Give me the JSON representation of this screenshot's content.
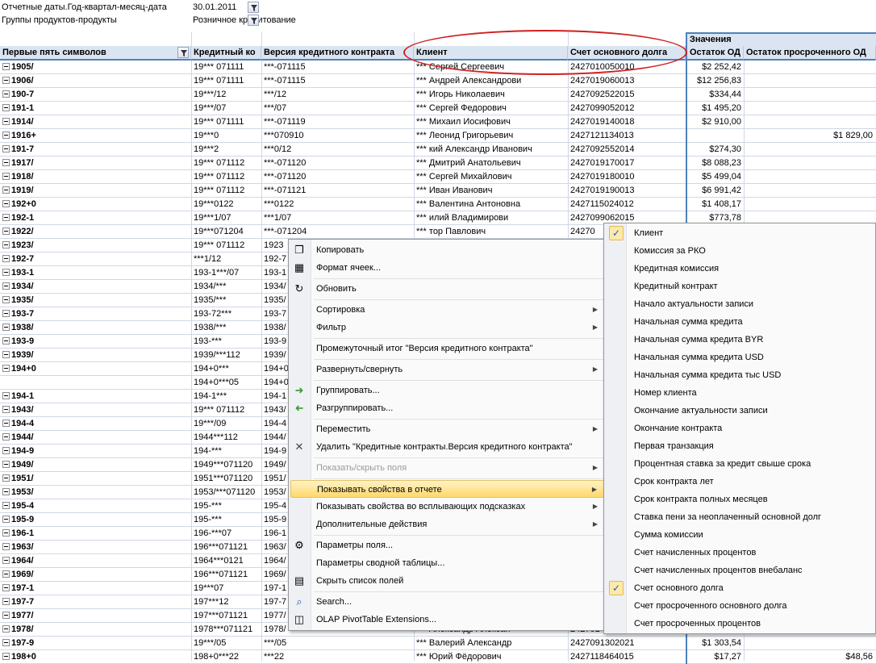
{
  "filters": {
    "row1": {
      "label": "Отчетные даты.Год-квартал-месяц-дата",
      "value": "30.01.2011"
    },
    "row2": {
      "label": "Группы продуктов-продукты",
      "value": "Розничное кредитование"
    }
  },
  "values_header": "Значения",
  "columns": [
    "Первые пять символов",
    "Кредитный ко",
    "Версия кредитного контракта",
    "Клиент",
    "Счет основного долга",
    "Остаток ОД",
    "Остаток просроченного ОД"
  ],
  "rows": [
    {
      "c0": "1905/",
      "c1": "19*** 071111",
      "c2": "***-071115",
      "c3": "*** Сергей Сергеевич",
      "c4": "2427010050010",
      "c5": "$2 252,42",
      "c6": ""
    },
    {
      "c0": "1906/",
      "c1": "19*** 071111",
      "c2": "***-071115",
      "c3": "*** Андрей Александрови",
      "c4": "2427019060013",
      "c5": "$12 256,83",
      "c6": ""
    },
    {
      "c0": "190-7",
      "c1": "19***/12",
      "c2": "***/12",
      "c3": "*** Игорь Николаевич",
      "c4": "2427092522015",
      "c5": "$334,44",
      "c6": ""
    },
    {
      "c0": "191-1",
      "c1": "19***/07",
      "c2": "***/07",
      "c3": "*** Сергей Федорович",
      "c4": "2427099052012",
      "c5": "$1 495,20",
      "c6": ""
    },
    {
      "c0": "1914/",
      "c1": "19*** 071111",
      "c2": "***-071119",
      "c3": "*** Михаил Иосифович",
      "c4": "2427019140018",
      "c5": "$2 910,00",
      "c6": ""
    },
    {
      "c0": "1916+",
      "c1": "19***0",
      "c2": "***070910",
      "c3": "*** Леонид Григорьевич",
      "c4": "2427121134013",
      "c5": "",
      "c6": "$1 829,00"
    },
    {
      "c0": "191-7",
      "c1": "19***2",
      "c2": "***0/12",
      "c3": "*** кий Александр Иванович",
      "c4": "2427092552014",
      "c5": "$274,30",
      "c6": ""
    },
    {
      "c0": "1917/",
      "c1": "19*** 071112",
      "c2": "***-071120",
      "c3": "*** Дмитрий Анатольевич",
      "c4": "2427019170017",
      "c5": "$8 088,23",
      "c6": ""
    },
    {
      "c0": "1918/",
      "c1": "19*** 071112",
      "c2": "***-071120",
      "c3": "*** Сергей Михайлович",
      "c4": "2427019180010",
      "c5": "$5 499,04",
      "c6": ""
    },
    {
      "c0": "1919/",
      "c1": "19*** 071112",
      "c2": "***-071121",
      "c3": "*** Иван Иванович",
      "c4": "2427019190013",
      "c5": "$6 991,42",
      "c6": ""
    },
    {
      "c0": "192+0",
      "c1": "19***0122",
      "c2": "***0122",
      "c3": "*** Валентина Антоновна",
      "c4": "2427115024012",
      "c5": "$1 408,17",
      "c6": ""
    },
    {
      "c0": "192-1",
      "c1": "19***1/07",
      "c2": "***1/07",
      "c3": "*** илий Владимирови",
      "c4": "2427099062015",
      "c5": "$773,78",
      "c6": ""
    },
    {
      "c0": "1922/",
      "c1": "19***071204",
      "c2": "***-071204",
      "c3": "*** тор Павлович",
      "c4": "24270",
      "c5": "",
      "c6": ""
    },
    {
      "c0": "1923/",
      "c1": "19*** 071112",
      "c2": "1923",
      "c3": "",
      "c4": "",
      "c5": "",
      "c6": ""
    },
    {
      "c0": "192-7",
      "c1": "***1/12",
      "c2": "192-7",
      "c3": "",
      "c4": "",
      "c5": "",
      "c6": ""
    },
    {
      "c0": "193-1",
      "c1": "193-1***/07",
      "c2": "193-1",
      "c3": "",
      "c4": "",
      "c5": "",
      "c6": ""
    },
    {
      "c0": "1934/",
      "c1": "1934/***",
      "c2": "1934/",
      "c3": "",
      "c4": "",
      "c5": "",
      "c6": ""
    },
    {
      "c0": "1935/",
      "c1": "1935/***",
      "c2": "1935/",
      "c3": "",
      "c4": "",
      "c5": "",
      "c6": ""
    },
    {
      "c0": "193-7",
      "c1": "193-72***",
      "c2": "193-7",
      "c3": "",
      "c4": "",
      "c5": "",
      "c6": ""
    },
    {
      "c0": "1938/",
      "c1": "1938/***",
      "c2": "1938/",
      "c3": "",
      "c4": "",
      "c5": "",
      "c6": ""
    },
    {
      "c0": "193-9",
      "c1": "193-***",
      "c2": "193-9",
      "c3": "",
      "c4": "",
      "c5": "",
      "c6": ""
    },
    {
      "c0": "1939/",
      "c1": "1939/***112",
      "c2": "1939/",
      "c3": "",
      "c4": "",
      "c5": "",
      "c6": ""
    },
    {
      "c0": "194+0",
      "c1": "194+0***",
      "c2": "194+0",
      "c3": "",
      "c4": "",
      "c5": "",
      "c6": ""
    },
    {
      "c0": "",
      "c1": "194+0***05",
      "c2": "194+0",
      "c3": "",
      "c4": "",
      "c5": "",
      "c6": ""
    },
    {
      "c0": "194-1",
      "c1": "194-1***",
      "c2": "194-1",
      "c3": "",
      "c4": "",
      "c5": "",
      "c6": ""
    },
    {
      "c0": "1943/",
      "c1": "19*** 071112",
      "c2": "1943/",
      "c3": "",
      "c4": "",
      "c5": "",
      "c6": ""
    },
    {
      "c0": "194-4",
      "c1": "19***/09",
      "c2": "194-4",
      "c3": "",
      "c4": "",
      "c5": "",
      "c6": ""
    },
    {
      "c0": "1944/",
      "c1": "1944***112",
      "c2": "1944/",
      "c3": "",
      "c4": "",
      "c5": "",
      "c6": ""
    },
    {
      "c0": "194-9",
      "c1": "194-***",
      "c2": "194-9",
      "c3": "",
      "c4": "",
      "c5": "",
      "c6": ""
    },
    {
      "c0": "1949/",
      "c1": "1949***071120",
      "c2": "1949/",
      "c3": "",
      "c4": "",
      "c5": "",
      "c6": ""
    },
    {
      "c0": "1951/",
      "c1": "1951***071120",
      "c2": "1951/",
      "c3": "",
      "c4": "",
      "c5": "",
      "c6": ""
    },
    {
      "c0": "1953/",
      "c1": "1953/***071120",
      "c2": "1953/",
      "c3": "",
      "c4": "",
      "c5": "",
      "c6": ""
    },
    {
      "c0": "195-4",
      "c1": "195-***",
      "c2": "195-4",
      "c3": "",
      "c4": "",
      "c5": "",
      "c6": ""
    },
    {
      "c0": "195-9",
      "c1": "195-***",
      "c2": "195-9",
      "c3": "",
      "c4": "",
      "c5": "",
      "c6": ""
    },
    {
      "c0": "196-1",
      "c1": "196-***07",
      "c2": "196-1",
      "c3": "",
      "c4": "",
      "c5": "",
      "c6": ""
    },
    {
      "c0": "1963/",
      "c1": "196***071121",
      "c2": "1963/",
      "c3": "",
      "c4": "",
      "c5": "",
      "c6": ""
    },
    {
      "c0": "1964/",
      "c1": "1964***0121",
      "c2": "1964/",
      "c3": "",
      "c4": "",
      "c5": "",
      "c6": ""
    },
    {
      "c0": "1969/",
      "c1": "196***071121",
      "c2": "1969/",
      "c3": "",
      "c4": "",
      "c5": "",
      "c6": ""
    },
    {
      "c0": "197-1",
      "c1": "19***07",
      "c2": "197-1",
      "c3": "",
      "c4": "",
      "c5": "",
      "c6": ""
    },
    {
      "c0": "197-7",
      "c1": "197***12",
      "c2": "197-7",
      "c3": "",
      "c4": "",
      "c5": "",
      "c6": ""
    },
    {
      "c0": "1977/",
      "c1": "197***071121",
      "c2": "1977/",
      "c3": "",
      "c4": "",
      "c5": "",
      "c6": ""
    },
    {
      "c0": "1978/",
      "c1": "1978***071121",
      "c2": "1978/",
      "c3": "*** Александр Алексан",
      "c4": "242701",
      "c5": "",
      "c6": ""
    },
    {
      "c0": "197-9",
      "c1": "19***/05",
      "c2": "***/05",
      "c3": "*** Валерий Александр",
      "c4": "2427091302021",
      "c5": "$1 303,54",
      "c6": ""
    },
    {
      "c0": "198+0",
      "c1": "198+0***22",
      "c2": "***22",
      "c3": "*** Юрий Фёдорович",
      "c4": "2427118464015",
      "c5": "$17,27",
      "c6": "$48,56"
    }
  ],
  "context_menu": {
    "items": [
      {
        "label": "Копировать",
        "icon": "copy-icon",
        "disabled": false,
        "submenu": false
      },
      {
        "label": "Формат ячеек...",
        "icon": "format-cells-icon",
        "disabled": false,
        "submenu": false
      },
      {
        "sep": true
      },
      {
        "label": "Обновить",
        "icon": "refresh-icon",
        "disabled": false,
        "submenu": false
      },
      {
        "sep": true
      },
      {
        "label": "Сортировка",
        "icon": "",
        "disabled": false,
        "submenu": true
      },
      {
        "label": "Фильтр",
        "icon": "",
        "disabled": false,
        "submenu": true
      },
      {
        "sep": true
      },
      {
        "label": "Промежуточный итог \"Версия кредитного контракта\"",
        "icon": "",
        "disabled": false,
        "submenu": false
      },
      {
        "sep": true
      },
      {
        "label": "Развернуть/свернуть",
        "icon": "",
        "disabled": false,
        "submenu": true
      },
      {
        "sep": true
      },
      {
        "label": "Группировать...",
        "icon": "group-icon",
        "disabled": false,
        "submenu": false
      },
      {
        "label": "Разгруппировать...",
        "icon": "ungroup-icon",
        "disabled": false,
        "submenu": false
      },
      {
        "sep": true
      },
      {
        "label": "Переместить",
        "icon": "",
        "disabled": false,
        "submenu": true
      },
      {
        "label": "Удалить \"Кредитные контракты.Версия кредитного контракта\"",
        "icon": "delete-icon",
        "disabled": false,
        "submenu": false
      },
      {
        "sep": true
      },
      {
        "label": "Показать/скрыть поля",
        "icon": "",
        "disabled": true,
        "submenu": true
      },
      {
        "sep": true
      },
      {
        "label": "Показывать свойства в отчете",
        "icon": "",
        "disabled": false,
        "submenu": true,
        "highlighted": true
      },
      {
        "label": "Показывать свойства во всплывающих подсказках",
        "icon": "",
        "disabled": false,
        "submenu": true
      },
      {
        "label": "Дополнительные действия",
        "icon": "",
        "disabled": false,
        "submenu": true
      },
      {
        "sep": true
      },
      {
        "label": "Параметры поля...",
        "icon": "field-settings-icon",
        "disabled": false,
        "submenu": false
      },
      {
        "label": "Параметры сводной таблицы...",
        "icon": "",
        "disabled": false,
        "submenu": false
      },
      {
        "label": "Скрыть список полей",
        "icon": "field-list-icon",
        "disabled": false,
        "submenu": false
      },
      {
        "sep": true
      },
      {
        "label": "Search...",
        "icon": "search-icon",
        "disabled": false,
        "submenu": false
      },
      {
        "label": "OLAP PivotTable Extensions...",
        "icon": "olap-icon",
        "disabled": false,
        "submenu": false
      }
    ]
  },
  "submenu": {
    "items": [
      {
        "label": "Клиент",
        "checked": true
      },
      {
        "label": "Комиссия за РКО",
        "checked": false
      },
      {
        "label": "Кредитная комиссия",
        "checked": false
      },
      {
        "label": "Кредитный контракт",
        "checked": false
      },
      {
        "label": "Начало актуальности записи",
        "checked": false
      },
      {
        "label": "Начальная сумма кредита",
        "checked": false
      },
      {
        "label": "Начальная сумма кредита BYR",
        "checked": false
      },
      {
        "label": "Начальная сумма кредита USD",
        "checked": false
      },
      {
        "label": "Начальная сумма кредита тыс USD",
        "checked": false
      },
      {
        "label": "Номер клиента",
        "checked": false
      },
      {
        "label": "Окончание актуальности записи",
        "checked": false
      },
      {
        "label": "Окончание контракта",
        "checked": false
      },
      {
        "label": "Первая транзакция",
        "checked": false
      },
      {
        "label": "Процентная ставка за кредит свыше срока",
        "checked": false
      },
      {
        "label": "Срок контракта лет",
        "checked": false
      },
      {
        "label": "Срок контракта полных месяцев",
        "checked": false
      },
      {
        "label": "Ставка пени за неоплаченный основной долг",
        "checked": false
      },
      {
        "label": "Сумма комиссии",
        "checked": false
      },
      {
        "label": "Счет начисленных процентов",
        "checked": false
      },
      {
        "label": "Счет начисленных процентов внебаланс",
        "checked": false
      },
      {
        "label": "Счет основного долга",
        "checked": true
      },
      {
        "label": "Счет просроченного основного долга",
        "checked": false
      },
      {
        "label": "Счет просроченных процентов",
        "checked": false
      }
    ]
  },
  "colors": {
    "header_bg": "#dbe5f1",
    "accent": "#4f81bd",
    "annotation": "#d02020",
    "highlight": "#ffd86a"
  }
}
